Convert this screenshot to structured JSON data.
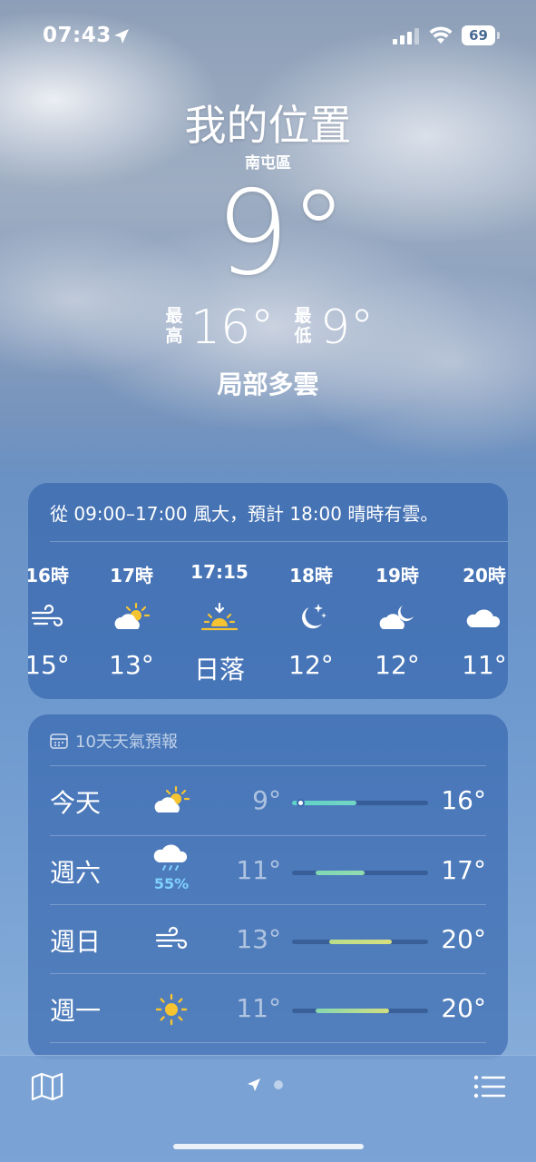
{
  "status_bar": {
    "time": "07:43",
    "battery": "69"
  },
  "header": {
    "title": "我的位置",
    "subtitle": "南屯區",
    "current_temp": "9°",
    "high_label": "最\n高",
    "high_label_1": "最",
    "high_label_2": "高",
    "high": "16°",
    "low_label_1": "最",
    "low_label_2": "低",
    "low": "9°",
    "condition": "局部多雲"
  },
  "hourly": {
    "summary": "從 09:00–17:00 風大，預計 18:00 晴時有雲。",
    "items": [
      {
        "time": "16時",
        "icon": "wind-icon",
        "temp": "15°"
      },
      {
        "time": "17時",
        "icon": "partly-sunny-icon",
        "temp": "13°"
      },
      {
        "time": "17:15",
        "icon": "sunset-icon",
        "temp": "日落"
      },
      {
        "time": "18時",
        "icon": "moon-stars-icon",
        "temp": "12°"
      },
      {
        "time": "19時",
        "icon": "partly-cloudy-night-icon",
        "temp": "12°"
      },
      {
        "time": "20時",
        "icon": "cloud-icon",
        "temp": "11°"
      }
    ]
  },
  "daily": {
    "header": "10天天氣預報",
    "days": [
      {
        "name": "今天",
        "icon": "partly-sunny-icon",
        "precip": "",
        "low": "9°",
        "high": "16°",
        "range_start": 0.0,
        "range_end": 0.47,
        "current": 0.06,
        "color_from": "#5ed1c9",
        "color_to": "#73d6c4"
      },
      {
        "name": "週六",
        "icon": "rain-icon",
        "precip": "55%",
        "low": "11°",
        "high": "17°",
        "range_start": 0.17,
        "range_end": 0.53,
        "color_from": "#7ed8b4",
        "color_to": "#93dcb0"
      },
      {
        "name": "週日",
        "icon": "wind-icon",
        "precip": "",
        "low": "13°",
        "high": "20°",
        "range_start": 0.27,
        "range_end": 0.73,
        "color_from": "#b9dd8c",
        "color_to": "#d6df7e"
      },
      {
        "name": "週一",
        "icon": "sun-icon",
        "precip": "",
        "low": "11°",
        "high": "20°",
        "range_start": 0.17,
        "range_end": 0.71,
        "color_from": "#86d8b0",
        "color_to": "#d2df80"
      }
    ]
  },
  "toolbar": {
    "map": "map-icon",
    "location": "location-arrow-icon",
    "list": "list-icon"
  }
}
